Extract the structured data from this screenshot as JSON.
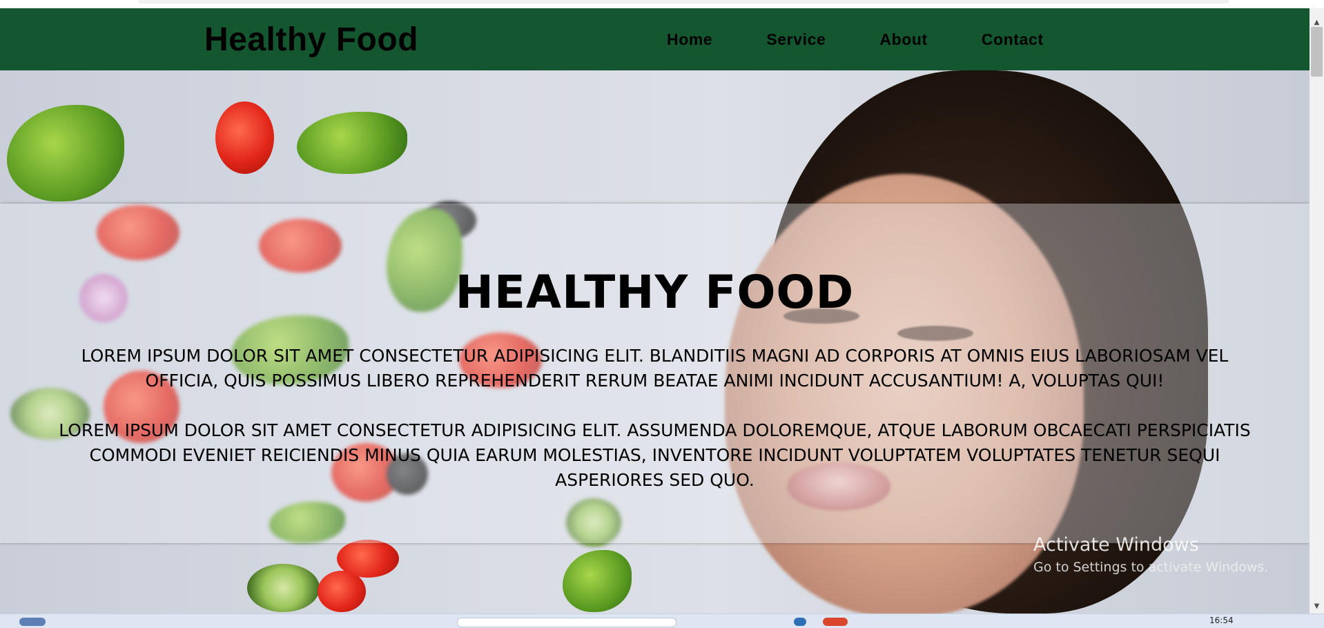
{
  "header": {
    "brand": "Healthy Food",
    "nav": [
      "Home",
      "Service",
      "About",
      "Contact"
    ]
  },
  "hero": {
    "title": "HEALTHY FOOD",
    "paragraph1": "Lorem ipsum dolor sit amet consectetur adipisicing elit. Blanditiis magni ad corporis at omnis eius laboriosam vel officia, quis possimus libero reprehenderit rerum beatae animi incidunt accusantium! A, voluptas qui!",
    "paragraph2": "Lorem ipsum dolor sit amet consectetur adipisicing elit. Assumenda doloremque, atque laborum obcaecati perspiciatis commodi eveniet reiciendis minus quia earum molestias, inventore incidunt voluptatem voluptates tenetur sequi asperiores sed quo."
  },
  "watermark": {
    "title": "Activate Windows",
    "subtitle": "Go to Settings to activate Windows."
  },
  "taskbar": {
    "clock": "16:54"
  },
  "colors": {
    "navbar": "#135630",
    "text": "#000000"
  },
  "icons": {
    "scroll_up": "chevron-up-icon",
    "scroll_down": "chevron-down-icon"
  }
}
